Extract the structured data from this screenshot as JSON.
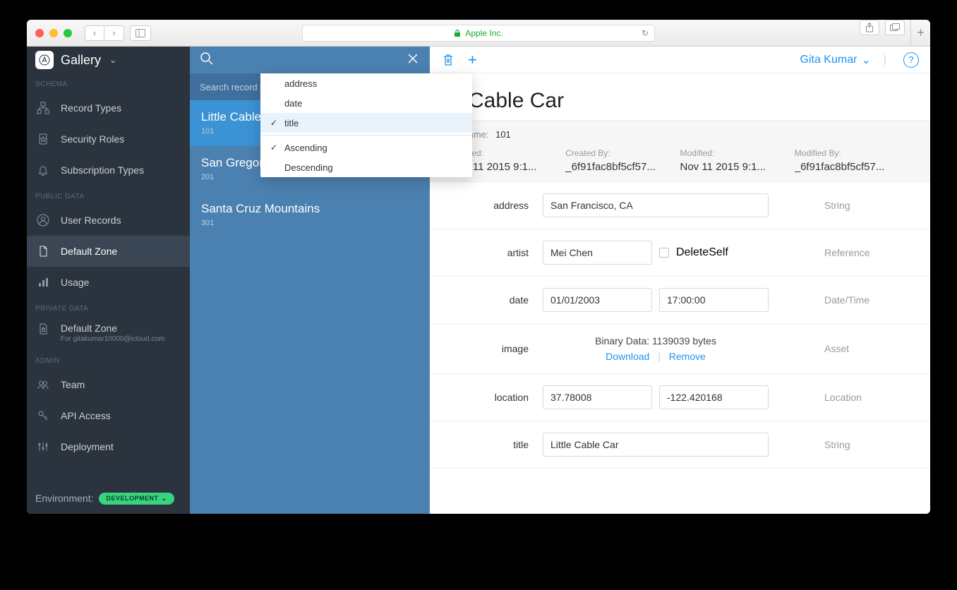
{
  "titlebar": {
    "address": "Apple Inc."
  },
  "sidebar": {
    "app_name": "Gallery",
    "sections": {
      "schema": "SCHEMA",
      "public": "PUBLIC DATA",
      "private": "PRIVATE DATA",
      "admin": "ADMIN"
    },
    "items": {
      "record_types": "Record Types",
      "security_roles": "Security Roles",
      "subscription_types": "Subscription Types",
      "user_records": "User Records",
      "default_zone": "Default Zone",
      "usage": "Usage",
      "priv_default_zone": "Default Zone",
      "priv_sub": "For gitakumar10000@icloud.com",
      "team": "Team",
      "api_access": "API Access",
      "deployment": "Deployment"
    },
    "env_label": "Environment:",
    "env_value": "DEVELOPMENT"
  },
  "reclist": {
    "search_placeholder": "Search record t",
    "records": [
      {
        "title": "Little Cable Car",
        "id": "101"
      },
      {
        "title": "San Gregorio Beach",
        "id": "201"
      },
      {
        "title": "Santa Cruz Mountains",
        "id": "301"
      }
    ]
  },
  "dropdown": {
    "address": "address",
    "date": "date",
    "title": "title",
    "asc": "Ascending",
    "desc": "Descending"
  },
  "detail": {
    "user": "Gita Kumar",
    "title_visible": "e Cable Car",
    "record_name_label": "rd Name:",
    "record_name": "101",
    "meta": {
      "created_lbl": "Created:",
      "created": "Nov 11 2015 9:1...",
      "created_by_lbl": "Created By:",
      "created_by": "_6f91fac8bf5cf57...",
      "modified_lbl": "Modified:",
      "modified": "Nov 11 2015 9:1...",
      "modified_by_lbl": "Modified By:",
      "modified_by": "_6f91fac8bf5cf57..."
    },
    "fields": {
      "address": {
        "label": "address",
        "value": "San Francisco, CA",
        "type": "String"
      },
      "artist": {
        "label": "artist",
        "value": "Mei Chen",
        "delete_self": "DeleteSelf",
        "type": "Reference"
      },
      "date": {
        "label": "date",
        "d": "01/01/2003",
        "t": "17:00:00",
        "type": "Date/Time"
      },
      "image": {
        "label": "image",
        "binary": "Binary Data: 1139039 bytes",
        "download": "Download",
        "remove": "Remove",
        "type": "Asset"
      },
      "location": {
        "label": "location",
        "lat": "37.78008",
        "lon": "-122.420168",
        "type": "Location"
      },
      "title": {
        "label": "title",
        "value": "Little Cable Car",
        "type": "String"
      }
    }
  }
}
